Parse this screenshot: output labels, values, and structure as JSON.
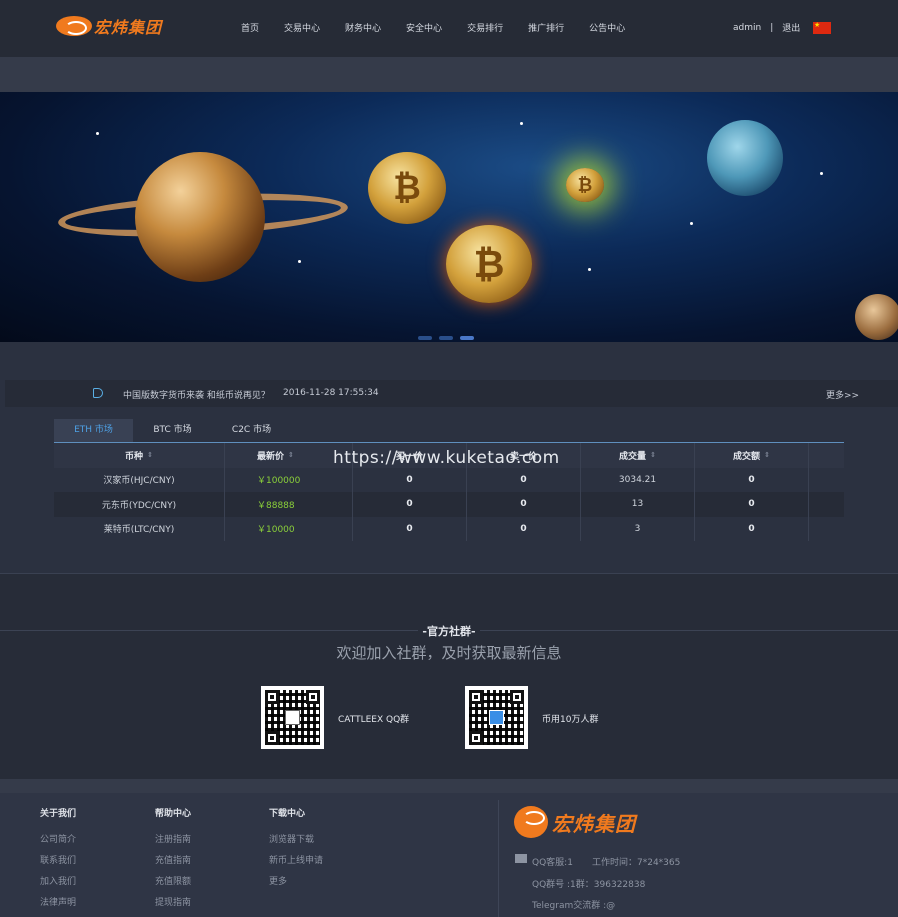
{
  "header": {
    "logo_text": "宏炜集团",
    "nav": [
      "首页",
      "交易中心",
      "财务中心",
      "安全中心",
      "交易排行",
      "推广排行",
      "公告中心"
    ],
    "user": "admin",
    "separator": "|",
    "logout": "退出"
  },
  "notice": {
    "text": "中国版数字货币来袭 和纸币说再见？",
    "time": "2016-11-28 17:55:34",
    "more": "更多>>"
  },
  "market": {
    "tabs": [
      "ETH 市场",
      "BTC 市场",
      "C2C 市场"
    ],
    "headers": [
      "币种",
      "最新价",
      "买一价",
      "卖一价",
      "成交量",
      "成交额"
    ],
    "rows": [
      {
        "coin": "汉家币(HJC/CNY)",
        "price": "￥100000",
        "buy": "0",
        "sell": "0",
        "volume": "3034.21",
        "amount": "0"
      },
      {
        "coin": "元东币(YDC/CNY)",
        "price": "￥88888",
        "buy": "0",
        "sell": "0",
        "volume": "13",
        "amount": "0"
      },
      {
        "coin": "莱特币(LTC/CNY)",
        "price": "￥10000",
        "buy": "0",
        "sell": "0",
        "volume": "3",
        "amount": "0"
      }
    ]
  },
  "watermark": "https://www.kuketao.com",
  "community": {
    "title": "-官方社群-",
    "subtitle": "欢迎加入社群，及时获取最新信息",
    "groups": [
      {
        "label": "CATTLEEX QQ群"
      },
      {
        "label": "币用10万人群"
      }
    ]
  },
  "footer": {
    "columns": [
      {
        "title": "关于我们",
        "links": [
          "公司简介",
          "联系我们",
          "加入我们",
          "法律声明"
        ]
      },
      {
        "title": "帮助中心",
        "links": [
          "注册指南",
          "充值指南",
          "充值限额",
          "提现指南"
        ]
      },
      {
        "title": "下载中心",
        "links": [
          "浏览器下载",
          "新币上线申请",
          "更多"
        ]
      }
    ],
    "logo_text": "宏炜集团",
    "qq_service": "QQ客服:1",
    "work_time": "工作时间：7*24*365",
    "qq_group": "QQ群号 :1群：396322838",
    "telegram": "Telegram交流群 :@"
  },
  "colors": {
    "accent": "#f07a1e",
    "price_green": "#8bd03a",
    "tab_active": "#4ea0e4"
  }
}
